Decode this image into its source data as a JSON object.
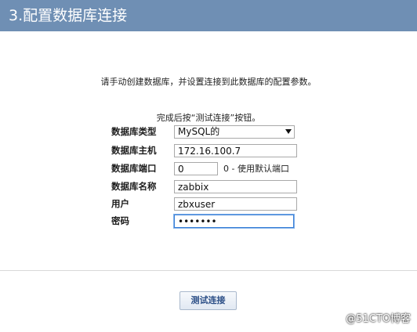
{
  "header": {
    "title": "3.配置数据库连接"
  },
  "intro": {
    "line1": "请手动创建数据库，并设置连接到此数据库的配置参数。",
    "line2": "完成后按“测试连接”按钮。"
  },
  "form": {
    "db_type": {
      "label": "数据库类型",
      "value": "MySQL的"
    },
    "db_host": {
      "label": "数据库主机",
      "value": "172.16.100.7"
    },
    "db_port": {
      "label": "数据库端口",
      "value": "0",
      "hint": "0 - 使用默认端口"
    },
    "db_name": {
      "label": "数据库名称",
      "value": "zabbix"
    },
    "user": {
      "label": "用户",
      "value": "zbxuser"
    },
    "password": {
      "label": "密码",
      "value": "•••••••"
    }
  },
  "actions": {
    "test_label": "测试连接"
  },
  "watermark": {
    "text": "@51CTO博客"
  }
}
